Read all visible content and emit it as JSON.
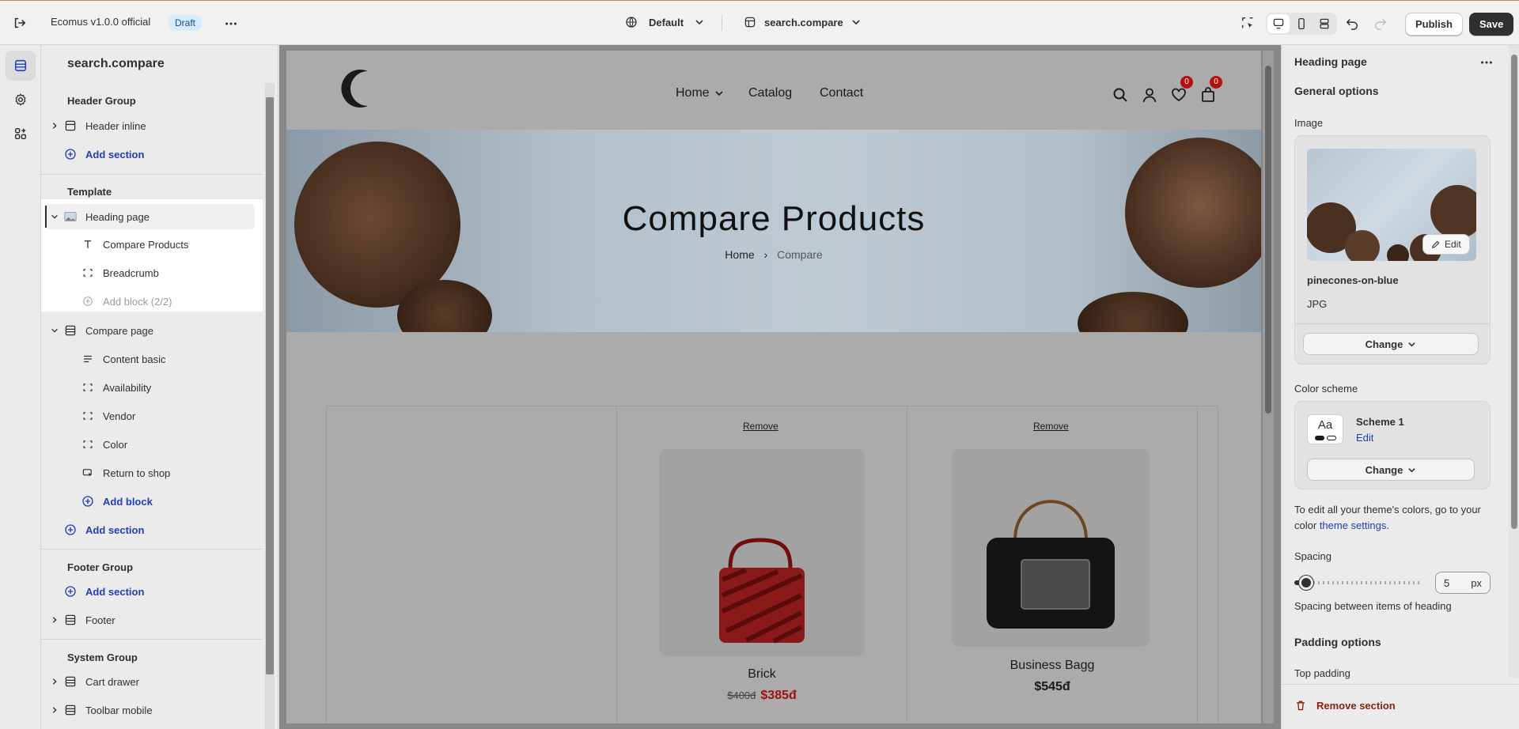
{
  "topbar": {
    "store_name": "Ecomus v1.0.0 official",
    "status_badge": "Draft",
    "theme_selector": "Default",
    "template_selector": "search.compare",
    "publish_label": "Publish",
    "save_label": "Save"
  },
  "left_panel": {
    "title": "search.compare",
    "header_group": {
      "label": "Header Group",
      "items": [
        {
          "label": "Header inline"
        }
      ],
      "add_section": "Add section"
    },
    "template": {
      "label": "Template",
      "heading_page": {
        "label": "Heading page",
        "blocks": [
          {
            "label": "Compare Products"
          },
          {
            "label": "Breadcrumb"
          }
        ],
        "add_block": "Add block (2/2)"
      },
      "compare_page": {
        "label": "Compare page",
        "blocks": [
          {
            "label": "Content basic"
          },
          {
            "label": "Availability"
          },
          {
            "label": "Vendor"
          },
          {
            "label": "Color"
          },
          {
            "label": "Return to shop"
          }
        ],
        "add_block": "Add block"
      },
      "add_section": "Add section"
    },
    "footer_group": {
      "label": "Footer Group",
      "add_section": "Add section",
      "items": [
        {
          "label": "Footer"
        }
      ]
    },
    "system_group": {
      "label": "System Group",
      "items": [
        {
          "label": "Cart drawer"
        },
        {
          "label": "Toolbar mobile"
        }
      ]
    }
  },
  "preview": {
    "nav": [
      "Home",
      "Catalog",
      "Contact"
    ],
    "wishlist_count": "0",
    "cart_count": "0",
    "hero_title": "Compare Products",
    "breadcrumb": {
      "home": "Home",
      "current": "Compare"
    },
    "products": [
      {
        "remove": "Remove",
        "name": "Brick",
        "old_price": "$400đ",
        "price": "$385đ"
      },
      {
        "remove": "Remove",
        "name": "Business Bagg",
        "price": "$545đ"
      }
    ]
  },
  "right_panel": {
    "title": "Heading page",
    "general_options": "General options",
    "image_label": "Image",
    "image_edit": "Edit",
    "image_name": "pinecones-on-blue",
    "image_type": "JPG",
    "change_label": "Change",
    "color_scheme_label": "Color scheme",
    "scheme_swatch": "Aa",
    "scheme_name": "Scheme 1",
    "scheme_edit": "Edit",
    "scheme_change": "Change",
    "theme_note_prefix": "To edit all your theme's colors, go to your color",
    "theme_note_link": "theme settings",
    "theme_note_suffix": ".",
    "spacing_label": "Spacing",
    "spacing_value": "5",
    "spacing_unit": "px",
    "spacing_level": 0.05,
    "spacing_help": "Spacing between items of heading",
    "padding_options": "Padding options",
    "top_padding": "Top padding",
    "remove_section": "Remove section"
  },
  "colors": {
    "accent": "#1f3fb8",
    "primary_button": "#303030",
    "badge_bg": "#d5ebff",
    "sale_price": "#a11010",
    "danger": "#8e1f0b"
  }
}
